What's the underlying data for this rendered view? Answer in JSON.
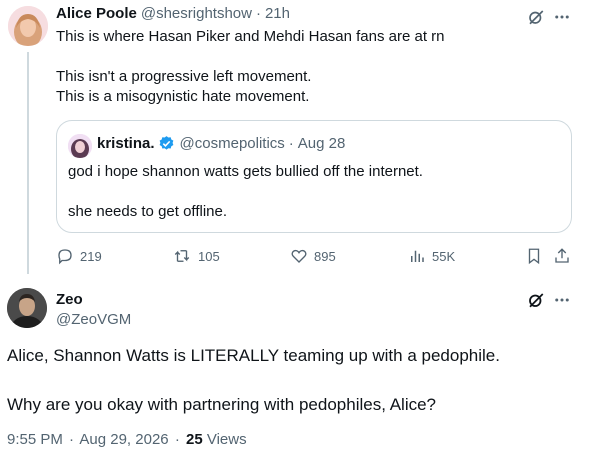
{
  "reply_parent": {
    "author_name": "Alice Poole",
    "handle": "@shesrightshow",
    "separator": "·",
    "time": "21h",
    "text_line1": "This is where Hasan Piker and Mehdi Hasan fans are at rn",
    "text_line2": "This isn't a progressive left movement.",
    "text_line3": "This is a misogynistic hate movement.",
    "quote": {
      "author_name": "kristina.",
      "handle": "@cosmepolitics",
      "separator": "·",
      "date": "Aug 28",
      "line1": "god i hope shannon watts gets bullied off the internet.",
      "line2": "she needs to get offline."
    },
    "actions": {
      "replies": "219",
      "reposts": "105",
      "likes": "895",
      "views": "55K"
    }
  },
  "main_post": {
    "author_name": "Zeo",
    "handle": "@ZeoVGM",
    "text_line1": "Alice, Shannon Watts is LITERALLY teaming up with a pedophile.",
    "text_line2": "Why are you okay with partnering with pedophiles, Alice?",
    "meta_time": "9:55 PM",
    "meta_sep": "·",
    "meta_date": "Aug 29, 2026",
    "views_count": "25",
    "views_label": "Views"
  },
  "colors": {
    "text": "#0f1419",
    "muted": "#536471",
    "border": "#cfd9de",
    "verified": "#1d9bf0"
  }
}
